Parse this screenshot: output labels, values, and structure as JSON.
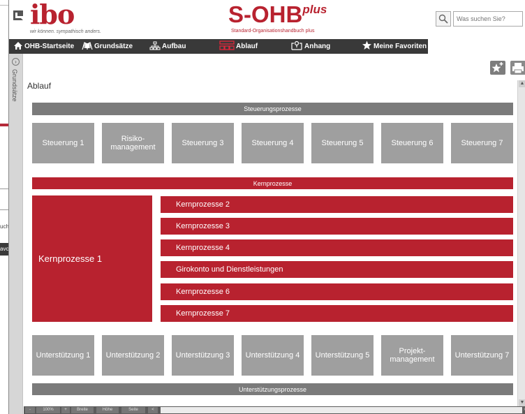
{
  "background_window": {
    "fragment_1": "uch",
    "fragment_2": "avo"
  },
  "header": {
    "logo": "ibo",
    "logo_tagline": "wir können. sympathisch anders.",
    "brand": "S-OHB",
    "brand_suffix": "plus",
    "brand_subtitle": "Standard-Organisationshandbuch plus",
    "search_placeholder": "Was suchen Sie?"
  },
  "nav": {
    "items": [
      {
        "label": "OHB-Startseite",
        "icon": "home-icon"
      },
      {
        "label": "Grundsätze",
        "icon": "book-icon"
      },
      {
        "label": "Aufbau",
        "icon": "org-chart-icon"
      },
      {
        "label": "Ablauf",
        "icon": "flow-icon"
      },
      {
        "label": "Anhang",
        "icon": "attachment-icon"
      },
      {
        "label": "Meine Favoriten",
        "icon": "star-icon"
      }
    ]
  },
  "sidebar": {
    "label": "Grundsätze"
  },
  "page": {
    "title": "Ablauf"
  },
  "diagram": {
    "steuerung_header": "Steuerungsprozesse",
    "steuerung_items": [
      "Steuerung 1",
      "Risiko-\nmanagement",
      "Steuerung 3",
      "Steuerung 4",
      "Steuerung 5",
      "Steuerung 6",
      "Steuerung 7"
    ],
    "kern_header": "Kernprozesse",
    "kern_main": "Kernprozesse 1",
    "kern_items": [
      "Kernprozesse 2",
      "Kernprozesse 3",
      "Kernprozesse 4",
      "Girokonto und Dienstleistungen",
      "Kernprozesse 6",
      "Kernprozesse 7"
    ],
    "unterstuetzung_items": [
      "Unterstützung 1",
      "Unterstützung 2",
      "Unterstützung 3",
      "Unterstützung 4",
      "Unterstützung 5",
      "Projekt-\nmanagement",
      "Unterstützung 7"
    ],
    "unterstuetzung_footer": "Unterstützungsprozesse"
  },
  "statusbar": {
    "zoom": "100%",
    "minus": "-",
    "plus": "+",
    "width": "Breite",
    "height": "Höhe",
    "page": "Seite",
    "scroll_left": "<",
    "scroll_right": ">"
  },
  "colors": {
    "red": "#b8222f",
    "gray_box": "#9f9f9f",
    "gray_bar": "#7b7b7b",
    "nav_bg": "#393939"
  }
}
